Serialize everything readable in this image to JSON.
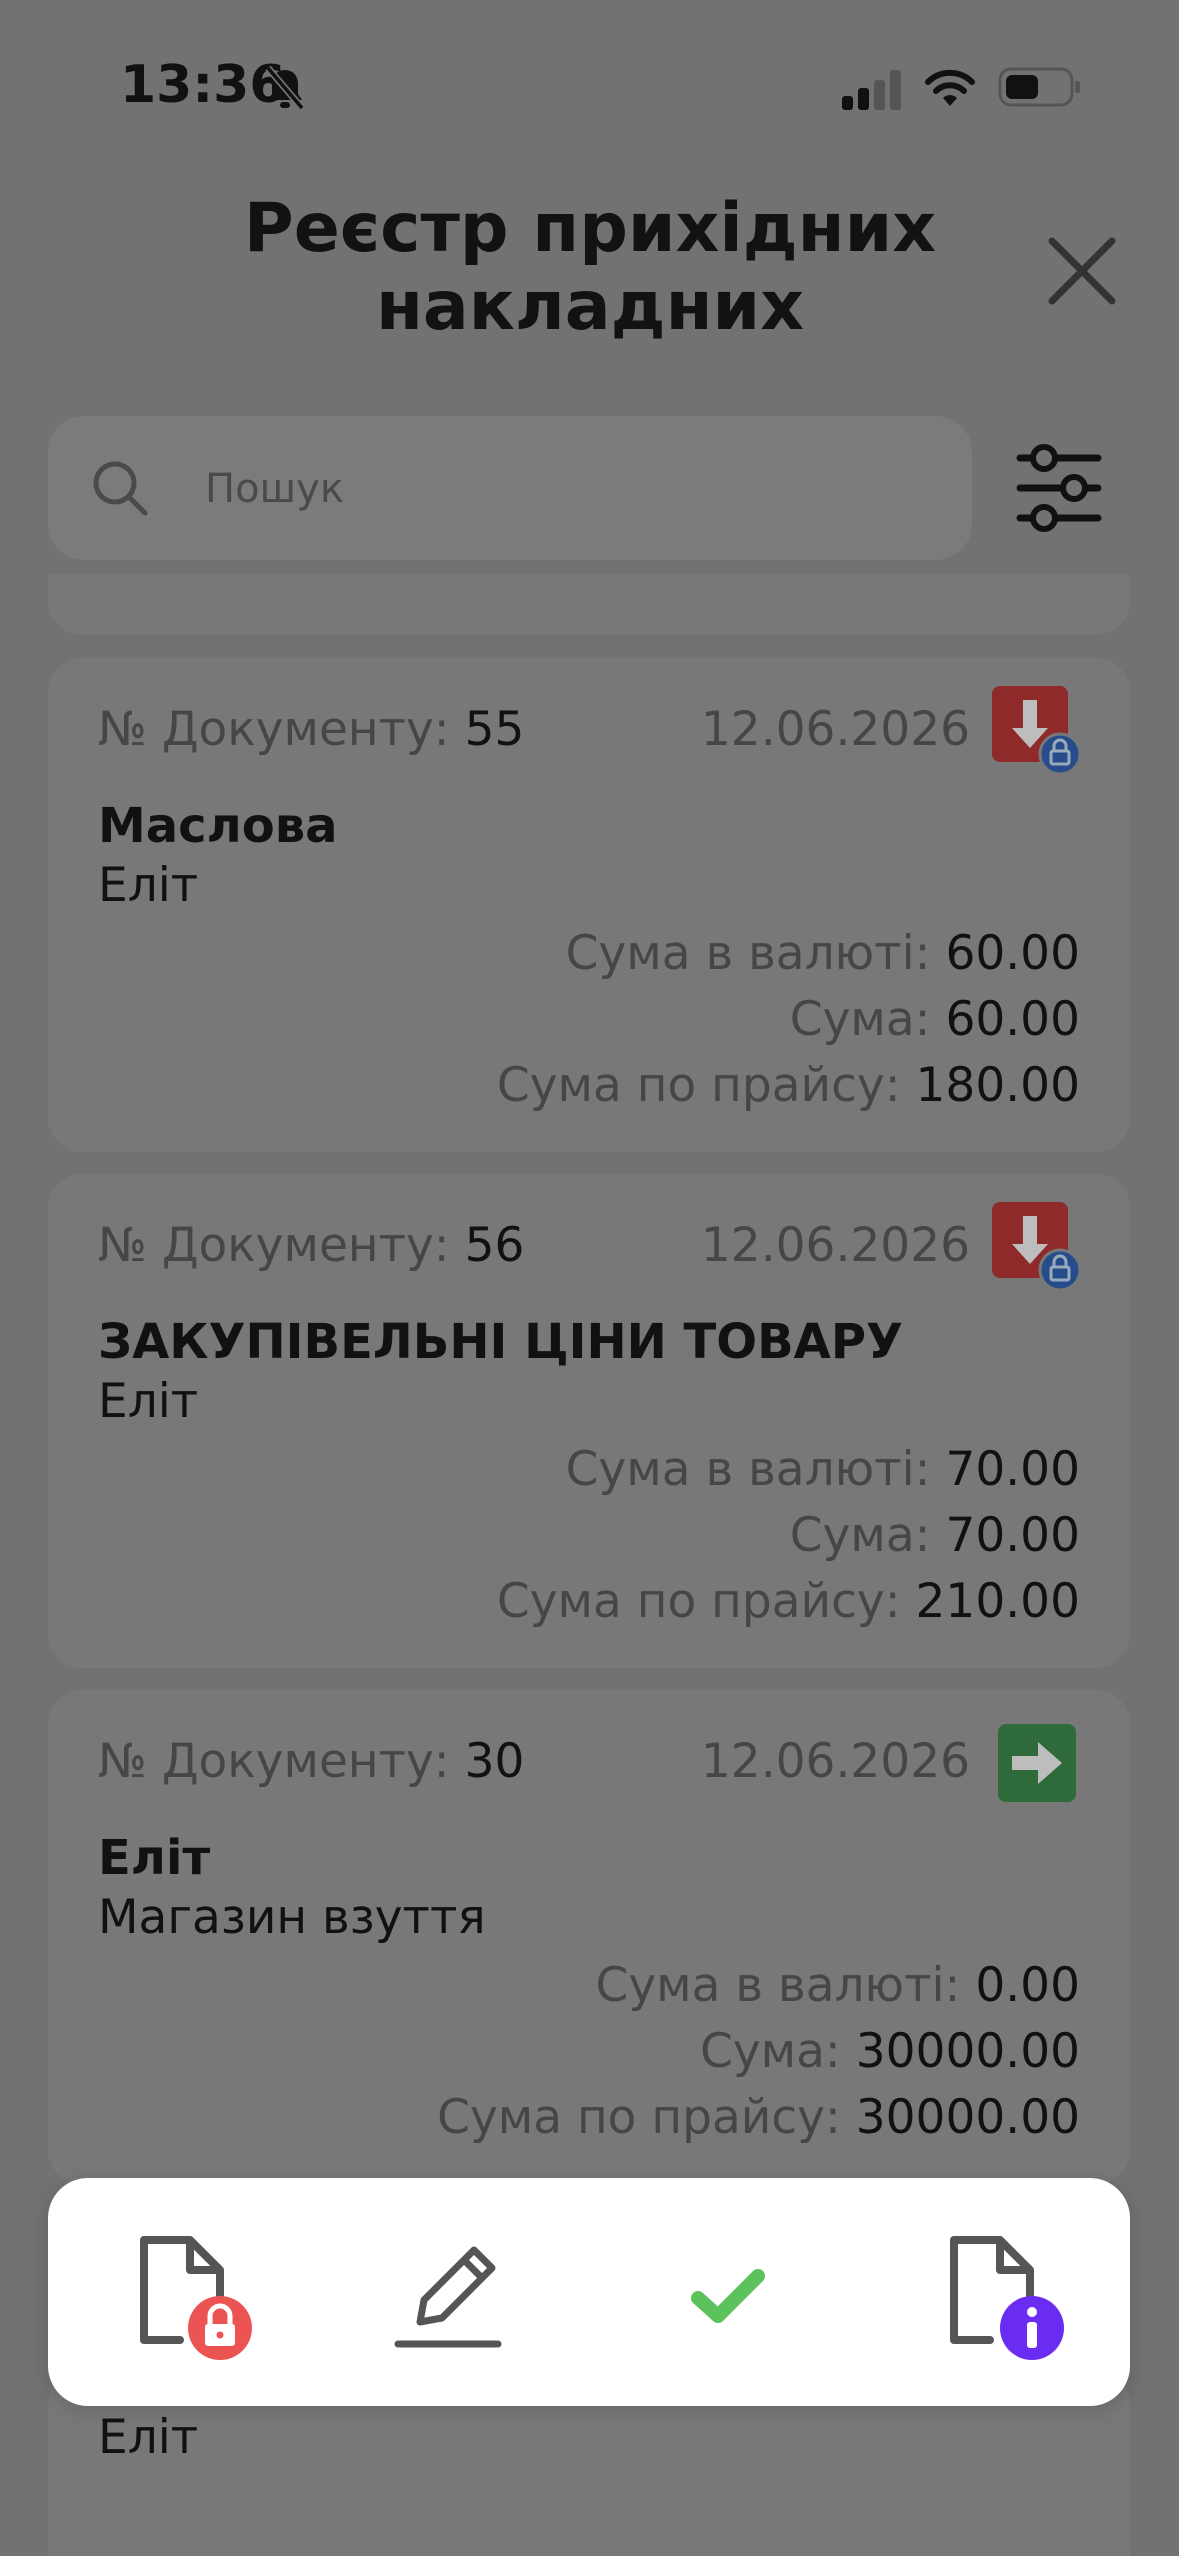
{
  "status_bar": {
    "time": "13:36"
  },
  "header": {
    "title_line1": "Реєстр прихідних",
    "title_line2": "накладних"
  },
  "search": {
    "placeholder": "Пошук",
    "value": ""
  },
  "labels": {
    "doc_number": "№ Документу:",
    "sum_currency": "Сума в валюті:",
    "sum": "Сума:",
    "sum_price": "Сума по прайсу:"
  },
  "documents": [
    {
      "number": "55",
      "date": "12.06.2026",
      "name": "Маслова",
      "sub": "Еліт",
      "sum_currency": "60.00",
      "sum": "60.00",
      "sum_price": "180.00",
      "status_icon": "incoming-locked-icon"
    },
    {
      "number": "56",
      "date": "12.06.2026",
      "name": "ЗАКУПІВЕЛЬНІ ЦІНИ ТОВАРУ",
      "sub": "Еліт",
      "sum_currency": "70.00",
      "sum": "70.00",
      "sum_price": "210.00",
      "status_icon": "incoming-locked-icon"
    },
    {
      "number": "30",
      "date": "12.06.2026",
      "name": "Еліт",
      "sub": "Магазин взуття",
      "sum_currency": "0.00",
      "sum": "30000.00",
      "sum_price": "30000.00",
      "status_icon": "transfer-arrow-icon"
    }
  ],
  "partial_item": {
    "sub": "Еліт"
  },
  "action_bar": {
    "actions": [
      "lock-document-icon",
      "edit-pencil-icon",
      "check-icon",
      "document-info-icon"
    ]
  },
  "colors": {
    "overlay": "#727272",
    "card": "#787878",
    "incoming_red": "#8f2a2a",
    "lock_blue": "#274c8c",
    "transfer_green": "#2e6a3a",
    "lock_red": "#ec5454",
    "check_green": "#5cc25c",
    "info_purple": "#6a2cf0"
  }
}
